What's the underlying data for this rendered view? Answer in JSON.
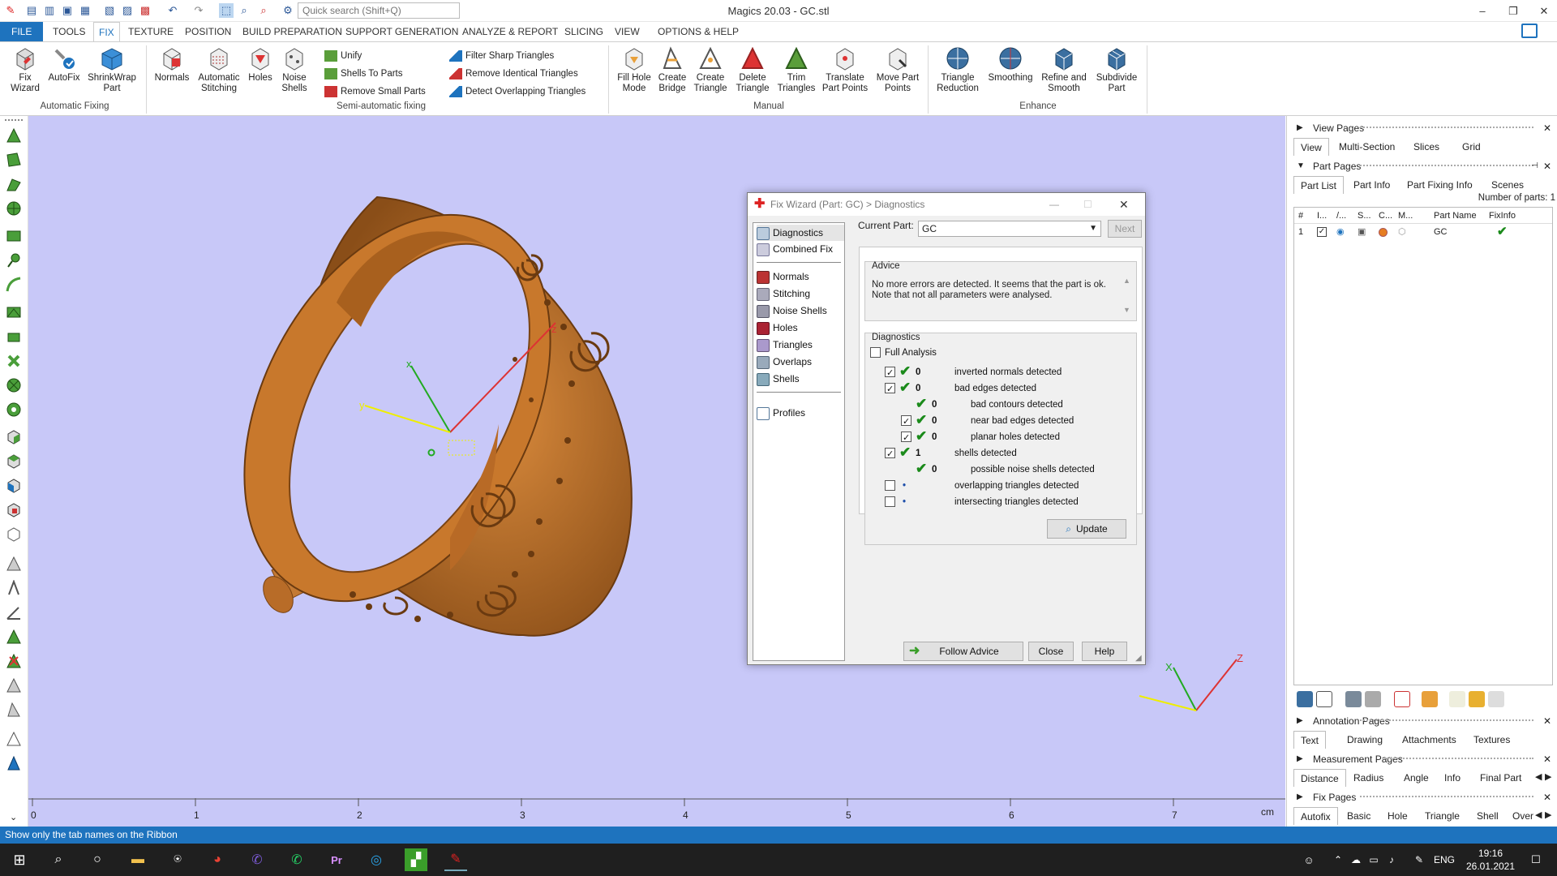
{
  "app": {
    "title": "Magics 20.03 - GC.stl",
    "search_placeholder": "Quick search (Shift+Q)"
  },
  "ribbon_tabs": [
    "FILE",
    "TOOLS",
    "FIX",
    "TEXTURE",
    "POSITION",
    "BUILD PREPARATION",
    "SUPPORT GENERATION",
    "ANALYZE & REPORT",
    "SLICING",
    "VIEW",
    "OPTIONS & HELP"
  ],
  "ribbon": {
    "fix_wizard": "Fix\nWizard",
    "autofix": "AutoFix",
    "shrinkwrap": "ShrinkWrap\nPart",
    "group_auto": "Automatic Fixing",
    "normals": "Normals",
    "auto_stitching": "Automatic\nStitching",
    "holes": "Holes",
    "noise_shells": "Noise\nShells",
    "unify": "Unify",
    "shells_to_parts": "Shells To Parts",
    "remove_small_parts": "Remove Small Parts",
    "filter_sharp": "Filter Sharp Triangles",
    "remove_identical": "Remove Identical Triangles",
    "detect_overlapping": "Detect Overlapping Triangles",
    "group_semi": "Semi-automatic fixing",
    "fill_hole_mode": "Fill Hole\nMode",
    "create_bridge": "Create\nBridge",
    "create_triangle": "Create\nTriangle",
    "delete_triangle": "Delete\nTriangle",
    "trim_triangles": "Trim\nTriangles",
    "translate_part_points": "Translate\nPart Points",
    "move_part_points": "Move Part\nPoints",
    "group_manual": "Manual",
    "triangle_reduction": "Triangle\nReduction",
    "smoothing": "Smoothing",
    "refine_smooth": "Refine and\nSmooth",
    "subdivide_part": "Subdivide\nPart",
    "group_enhance": "Enhance"
  },
  "viewport": {
    "ruler_labels": [
      "0",
      "1",
      "2",
      "3",
      "4",
      "5",
      "6",
      "7"
    ],
    "ruler_unit": "cm",
    "axis_x": "x",
    "axis_y": "y",
    "axis_z": "z",
    "triad_x": "X",
    "triad_z": "Z"
  },
  "dialog": {
    "title": "Fix Wizard (Part: GC) > Diagnostics",
    "nav": {
      "diagnostics": "Diagnostics",
      "combined_fix": "Combined Fix",
      "normals": "Normals",
      "stitching": "Stitching",
      "noise_shells": "Noise Shells",
      "holes": "Holes",
      "triangles": "Triangles",
      "overlaps": "Overlaps",
      "shells": "Shells",
      "profiles": "Profiles"
    },
    "current_part_label": "Current Part:",
    "current_part_value": "GC",
    "next": "Next",
    "advice_title": "Advice",
    "advice_text": "No more errors are detected. It seems that the part is ok. Note that not all parameters were analysed.",
    "diagnostics_title": "Diagnostics",
    "full_analysis": "Full Analysis",
    "rows": [
      {
        "label": "inverted normals detected",
        "value": "0"
      },
      {
        "label": "bad edges detected",
        "value": "0"
      },
      {
        "label": "bad contours detected",
        "value": "0"
      },
      {
        "label": "near bad edges detected",
        "value": "0"
      },
      {
        "label": "planar holes detected",
        "value": "0"
      },
      {
        "label": "shells detected",
        "value": "1"
      },
      {
        "label": "possible noise shells detected",
        "value": "0"
      },
      {
        "label": "overlapping triangles detected",
        "value": "•"
      },
      {
        "label": "intersecting triangles detected",
        "value": "•"
      }
    ],
    "update": "Update",
    "follow_advice": "Follow Advice",
    "close": "Close",
    "help": "Help"
  },
  "right_panel": {
    "view_pages": "View Pages",
    "view_tabs": [
      "View",
      "Multi-Section",
      "Slices",
      "Grid"
    ],
    "part_pages": "Part Pages",
    "part_tabs": [
      "Part List",
      "Part Info",
      "Part Fixing Info",
      "Scenes"
    ],
    "num_parts": "Number of parts: 1",
    "columns": [
      "#",
      "I...",
      "/...",
      "S...",
      "C...",
      "M...",
      "Part Name",
      "FixInfo"
    ],
    "row": {
      "num": "1",
      "name": "GC"
    },
    "annotation_pages": "Annotation Pages",
    "annotation_tabs": [
      "Text",
      "Drawing",
      "Attachments",
      "Textures"
    ],
    "measurement_pages": "Measurement Pages",
    "measurement_tabs": [
      "Distance",
      "Radius",
      "Angle",
      "Info",
      "Final Part"
    ],
    "fix_pages": "Fix Pages",
    "fix_tabs": [
      "Autofix",
      "Basic",
      "Hole",
      "Triangle",
      "Shell",
      "Over"
    ]
  },
  "status": "Show only the tab names on the Ribbon",
  "taskbar": {
    "lang": "ENG",
    "time": "19:16",
    "date": "26.01.2021"
  },
  "colors": {
    "accent": "#1e73be",
    "viewport": "#c8c8f8",
    "ring": "#c87a2e",
    "check": "#1a8a1a"
  }
}
